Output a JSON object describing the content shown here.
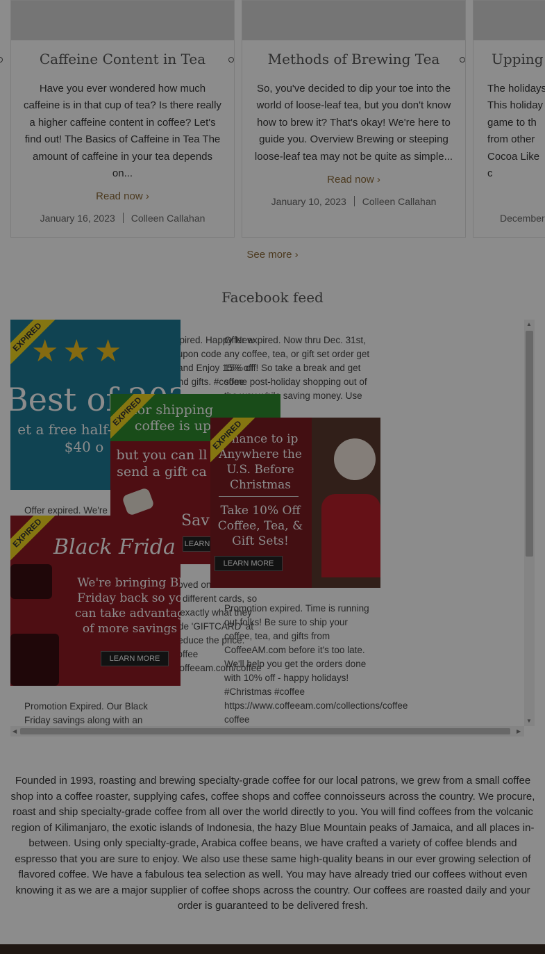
{
  "posts": [
    {
      "title": "Caffeine Content in Tea",
      "excerpt": "Have you ever wondered how much caffeine is in that cup of tea? Is there really a higher caffeine content in coffee? Let's find out! The Basics of Caffeine in Tea The amount of caffeine in your tea depends on...",
      "read": "Read now",
      "date": "January 16, 2023",
      "author": "Colleen Callahan"
    },
    {
      "title": "Methods of Brewing Tea",
      "excerpt": "So, you've decided to dip your toe into the world of loose-leaf tea, but you don't know how to brew it? That's okay! We're here to guide you. Overview Brewing or steeping loose-leaf tea may not be quite as simple...",
      "read": "Read now",
      "date": "January 10, 2023",
      "author": "Colleen Callahan"
    },
    {
      "title": "Upping Y",
      "excerpt": "The holidays\nThis holiday\ngame to th\nfrom other\nCocoa Like\nc",
      "date": "December"
    }
  ],
  "see_more": "See more",
  "facebook_heading": "Facebook feed",
  "feed": {
    "col2_top": "Promotion expired. Happy New Year! Use coupon code 'NEWYEAR' and Enjoy 15% off coffee, tea, and gifts. #coffee",
    "col3_top": "Offer expired. Now thru Dec. 31st, any coffee, tea, or gift set order get 15% off! So take a break and get some post-holiday shopping out of the way while saving money. Use the coupon",
    "col1_mid": "Offer expired. We're",
    "col2_mid": "expired. Let loved ones the choice from hundred different cards, so they can buy exactly what they want. Use code 'GIFTCARD' at checkout to reduce the price. #giftcards #coffee https://www.coffeeam.com/coffee cards",
    "col3_mid": "Promotion expired. Time is running out folks! Be sure to ship your coffee, tea, and gifts from CoffeeAM.com before it's too late. We'll help you get the orders done with 10% off - happy holidays! #Christmas #coffee https://www.coffeeam.com/collections/coffee coffee",
    "col1_bottom": "Promotion Expired. Our Black Friday savings along with an",
    "promo1": {
      "ribbon": "EXPIRED",
      "headline": "Best of 202",
      "sub": "et a free half-p any $40 o"
    },
    "promo2": {
      "ribbon": "EXPIRED",
      "headline": "for shipping coffee is up",
      "sub": "but you can ll send a gift ca",
      "save": "Sav",
      "btn": "LEARN"
    },
    "promo3": {
      "ribbon": "EXPIRED",
      "headline": "Chance to ip Anywhere the U.S. Before Christmas",
      "sub": "Take 10% Off Coffee, Tea, & Gift Sets!",
      "btn": "LEARN MORE"
    },
    "promo4": {
      "ribbon": "EXPIRED",
      "headline": "Black Frida",
      "sub": "We're bringing Bl Friday back so yo can take advantag of more savings",
      "btn": "LEARN MORE"
    }
  },
  "about": "Founded in 1993, roasting and brewing specialty-grade coffee for our local patrons, we grew from a small coffee shop into a coffee roaster, supplying cafes, coffee shops and coffee connoisseurs across the country. We procure, roast and ship specialty-grade coffee from all over the world directly to you. You will find coffees from the volcanic region of Kilimanjaro, the exotic islands of Indonesia, the hazy Blue Mountain peaks of Jamaica, and all places in-between. Using only specialty-grade, Arabica coffee beans, we have crafted a variety of coffee blends and espresso that you are sure to enjoy. We also use these same high-quality beans in our ever growing selection of flavored coffee. We have a fabulous tea selection as well. You may have already tried our coffees without even knowing it as we are a major supplier of coffee shops across the country. Our coffees are roasted daily and your order is guaranteed to be delivered fresh.",
  "colors": {
    "accent": "#8a6a3a",
    "teal": "#1e7b95",
    "red": "#8e1a24",
    "green": "#2f8a2f",
    "ribbon": "#f2d81f"
  }
}
